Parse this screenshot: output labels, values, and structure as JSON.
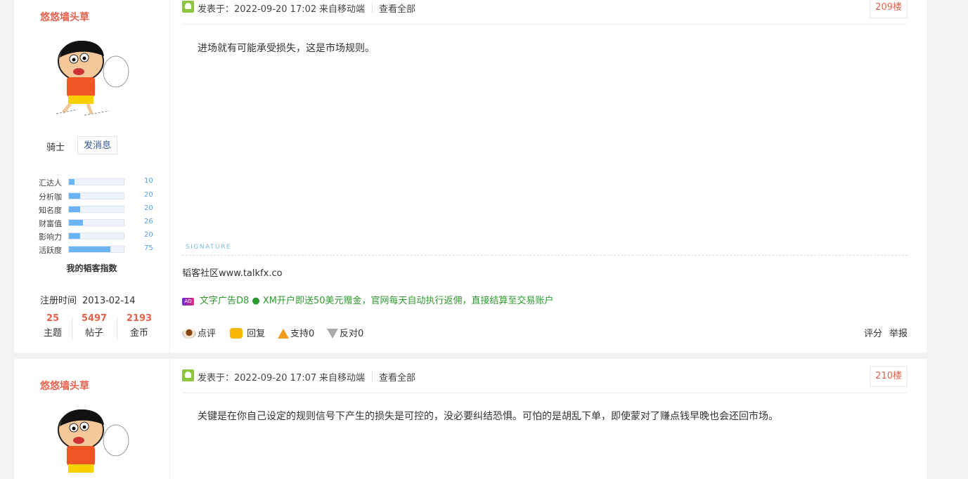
{
  "posts": [
    {
      "username": "悠悠墙头草",
      "rank": "骑士",
      "message_button": "发消息",
      "stats": [
        {
          "label": "汇达人",
          "value": "10",
          "percent": 10
        },
        {
          "label": "分析咖",
          "value": "20",
          "percent": 20
        },
        {
          "label": "知名度",
          "value": "20",
          "percent": 20
        },
        {
          "label": "财富值",
          "value": "26",
          "percent": 26
        },
        {
          "label": "影响力",
          "value": "20",
          "percent": 20
        },
        {
          "label": "活跃度",
          "value": "75",
          "percent": 75
        }
      ],
      "index_title": "我的韬客指数",
      "reg_label": "注册时间",
      "reg_date": "2013-02-14",
      "counts": [
        {
          "num": "25",
          "label": "主题"
        },
        {
          "num": "5497",
          "label": "帖子"
        },
        {
          "num": "2193",
          "label": "金币"
        }
      ],
      "posted": "发表于：2022-09-20 17:02",
      "source": "来自移动端",
      "view_all": "查看全部",
      "floor": "209楼",
      "content": "进场就有可能承受损失，这是市场规则。",
      "signature_label": "SIGNATURE",
      "signature": "韬客社区www.talkfx.co",
      "ad_icon": "AD",
      "ad_text": "文字广告D8 ● XM开户即送50美元赠金，官网每天自动执行返佣，直接结算至交易账户",
      "actions": {
        "comment": "点评",
        "reply": "回复",
        "support": "支持0",
        "oppose": "反对0",
        "rate": "评分",
        "report": "举报"
      }
    },
    {
      "username": "悠悠墙头草",
      "posted": "发表于：2022-09-20 17:07",
      "source": "来自移动端",
      "view_all": "查看全部",
      "floor": "210楼",
      "content": "关键是在你自己设定的规则信号下产生的损失是可控的，没必要纠结恐惧。可怕的是胡乱下单，即使蒙对了赚点钱早晚也会还回市场。"
    }
  ],
  "icons": {
    "avatar": "cartoon-boy-avatar",
    "post": "user-post-icon"
  },
  "colors": {
    "username": "#e8614c",
    "floor": "#e8614c",
    "ad": "#2e9b2e",
    "bar": "#6ab3f4"
  }
}
